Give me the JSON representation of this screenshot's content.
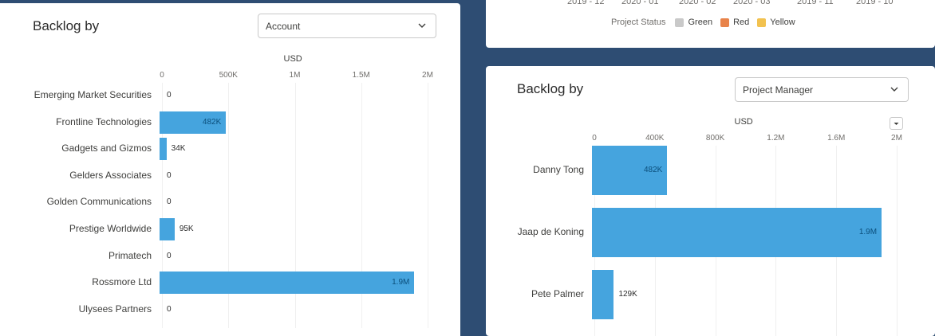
{
  "top_right": {
    "period_labels": [
      "2019 - 12",
      "2020 - 01",
      "2020 - 02",
      "2020 - 03",
      "2019 - 11",
      "2019 - 10"
    ],
    "legend_title": "Project Status",
    "legend_items": [
      {
        "label": "Green",
        "color": "#c9c9c9"
      },
      {
        "label": "Red",
        "color": "#e8834a"
      },
      {
        "label": "Yellow",
        "color": "#f2c250"
      }
    ]
  },
  "colors": {
    "bar": "#45a4de"
  },
  "icons": {
    "dropdown": "chevron-down-icon",
    "chart_menu": "chevron-down-icon"
  },
  "left_card": {
    "title": "Backlog by",
    "grouping_select": "Account"
  },
  "right_card": {
    "title": "Backlog by",
    "grouping_select": "Project Manager"
  },
  "chart_data": [
    {
      "type": "bar",
      "orientation": "horizontal",
      "xlabel": "USD",
      "xlim": [
        0,
        2000000
      ],
      "x_ticks": [
        0,
        500000,
        1000000,
        1500000,
        2000000
      ],
      "x_tick_labels": [
        "0",
        "500Κ",
        "1М",
        "1.5М",
        "2М"
      ],
      "categories": [
        "Emerging Market Securities",
        "Frontline Technologies",
        "Gadgets and Gizmos",
        "Gelders Associates",
        "Golden Communications",
        "Prestige Worldwide",
        "Primatech",
        "Rossmore Ltd",
        "Ulysees Partners"
      ],
      "values": [
        0,
        482000,
        34000,
        0,
        0,
        95000,
        0,
        1900000,
        0
      ],
      "value_labels": [
        "0",
        "482Κ",
        "34Κ",
        "0",
        "0",
        "95Κ",
        "0",
        "1.9М",
        "0"
      ],
      "grid": true
    },
    {
      "type": "bar",
      "orientation": "horizontal",
      "xlabel": "USD",
      "xlim": [
        0,
        2000000
      ],
      "x_ticks": [
        0,
        400000,
        800000,
        1200000,
        1600000,
        2000000
      ],
      "x_tick_labels": [
        "0",
        "400Κ",
        "800Κ",
        "1.2М",
        "1.6М",
        "2М"
      ],
      "categories": [
        "Danny Tong",
        "Jaap de Koning",
        "Pete Palmer"
      ],
      "values": [
        482000,
        1900000,
        129000
      ],
      "value_labels": [
        "482Κ",
        "1.9М",
        "129Κ"
      ],
      "grid": true
    }
  ]
}
